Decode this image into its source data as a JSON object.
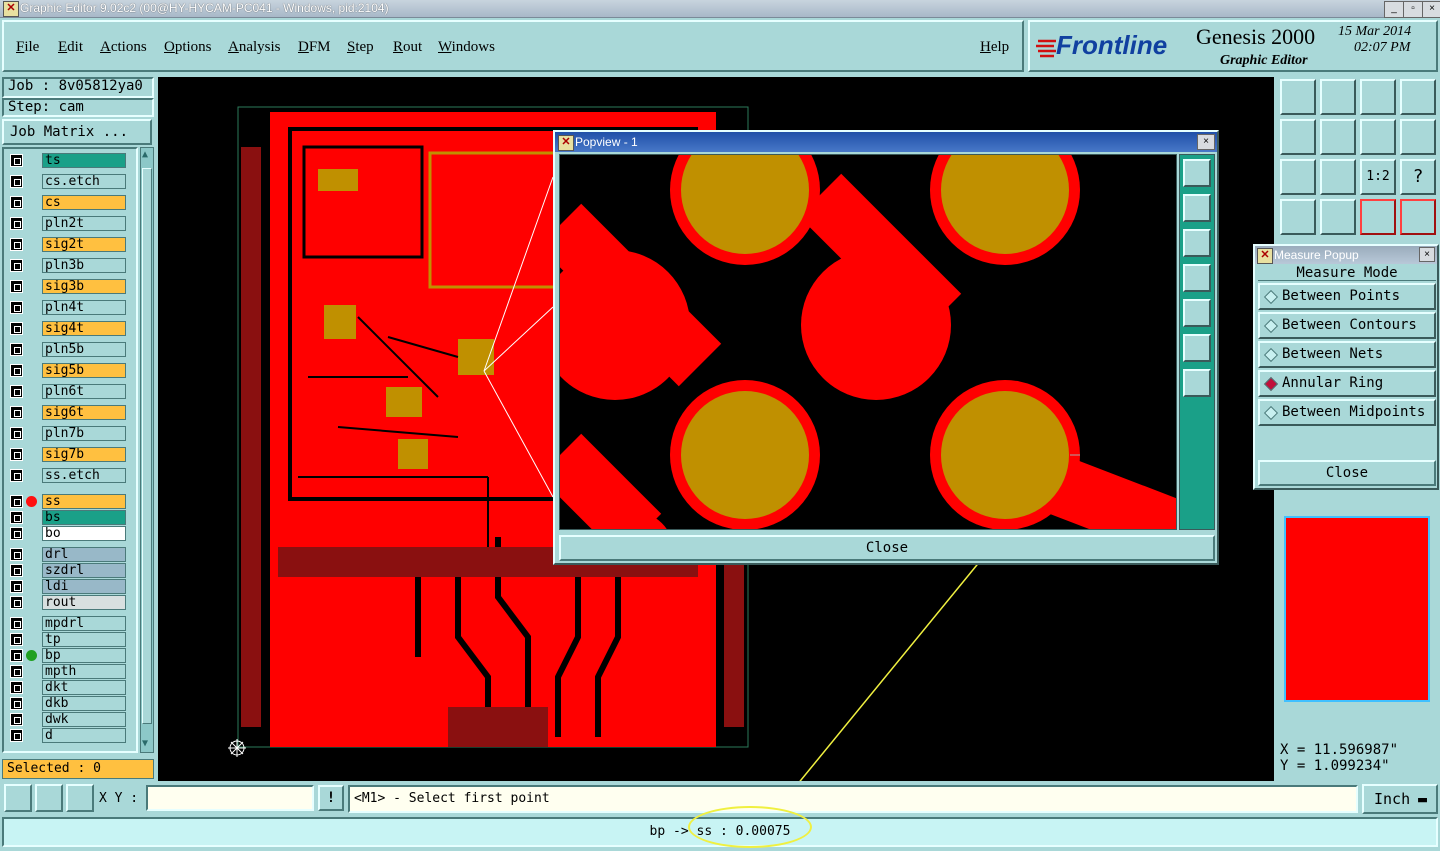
{
  "window": {
    "title": "Graphic Editor 9.02c2 (00@HY-HYCAM-PC041 - Windows, pid:2104)",
    "controls": [
      "_",
      "▫",
      "×"
    ]
  },
  "menubar": {
    "items": [
      "File",
      "Edit",
      "Actions",
      "Options",
      "Analysis",
      "DFM",
      "Step",
      "Rout",
      "Windows"
    ],
    "help": "Help"
  },
  "logo": {
    "brand": "Frontline",
    "product": "Genesis 2000",
    "subtitle": "Graphic Editor",
    "date": "15 Mar 2014",
    "time": "02:07 PM"
  },
  "job_panel": {
    "job": "Job : 8v05812ya0",
    "step": "Step: cam",
    "matrix_button": "Job Matrix ..."
  },
  "layers": [
    {
      "name": "ts",
      "color": "#1aa088",
      "marker": ""
    },
    {
      "name": "cs.etch",
      "color": "#a9d8d8",
      "marker": ""
    },
    {
      "name": "cs",
      "color": "#ffc040",
      "marker": ""
    },
    {
      "name": "pln2t",
      "color": "#a9d8d8",
      "marker": ""
    },
    {
      "name": "sig2t",
      "color": "#ffc040",
      "marker": ""
    },
    {
      "name": "pln3b",
      "color": "#a9d8d8",
      "marker": ""
    },
    {
      "name": "sig3b",
      "color": "#ffc040",
      "marker": ""
    },
    {
      "name": "pln4t",
      "color": "#a9d8d8",
      "marker": ""
    },
    {
      "name": "sig4t",
      "color": "#ffc040",
      "marker": ""
    },
    {
      "name": "pln5b",
      "color": "#a9d8d8",
      "marker": ""
    },
    {
      "name": "sig5b",
      "color": "#ffc040",
      "marker": ""
    },
    {
      "name": "pln6t",
      "color": "#a9d8d8",
      "marker": ""
    },
    {
      "name": "sig6t",
      "color": "#ffc040",
      "marker": ""
    },
    {
      "name": "pln7b",
      "color": "#a9d8d8",
      "marker": ""
    },
    {
      "name": "sig7b",
      "color": "#ffc040",
      "marker": ""
    },
    {
      "name": "ss.etch",
      "color": "#a9d8d8",
      "marker": ""
    },
    {
      "name": "ss",
      "color": "#ffc040",
      "marker": "red"
    },
    {
      "name": "bs",
      "color": "#1aa088",
      "marker": ""
    },
    {
      "name": "bo",
      "color": "#ffffff",
      "marker": ""
    },
    {
      "name": "drl",
      "color": "#98b8c8",
      "marker": ""
    },
    {
      "name": "szdrl",
      "color": "#98b8c8",
      "marker": ""
    },
    {
      "name": "ldi",
      "color": "#98b8c8",
      "marker": ""
    },
    {
      "name": "rout",
      "color": "#d8e0e0",
      "marker": ""
    },
    {
      "name": "mpdrl",
      "color": "#a9d8d8",
      "marker": ""
    },
    {
      "name": "tp",
      "color": "#a9d8d8",
      "marker": ""
    },
    {
      "name": "bp",
      "color": "#a9d8d8",
      "marker": "green"
    },
    {
      "name": "mpth",
      "color": "#a9d8d8",
      "marker": ""
    },
    {
      "name": "dkt",
      "color": "#a9d8d8",
      "marker": ""
    },
    {
      "name": "dkb",
      "color": "#a9d8d8",
      "marker": ""
    },
    {
      "name": "dwk",
      "color": "#a9d8d8",
      "marker": ""
    },
    {
      "name": "d",
      "color": "#a9d8d8",
      "marker": ""
    }
  ],
  "selected": "Selected : 0",
  "popview": {
    "title": "Popview - 1",
    "close": "Close"
  },
  "measure_popup": {
    "title": "Measure Popup",
    "header": "Measure Mode",
    "options": [
      {
        "label": "Between Points",
        "selected": false
      },
      {
        "label": "Between Contours",
        "selected": false
      },
      {
        "label": "Between Nets",
        "selected": false
      },
      {
        "label": "Annular Ring",
        "selected": true
      },
      {
        "label": "Between Midpoints",
        "selected": false
      }
    ],
    "close": "Close"
  },
  "toolbar_icons": [
    "home-up-icon",
    "home-down-icon",
    "home-icon",
    "split-icon",
    "move-left-icon",
    "move-right-icon",
    "swap-icon",
    "snake-icon",
    "fit-icon",
    "center-icon",
    "scale-1-2-icon",
    "help-icon",
    "tools-icon",
    "grid-icon",
    "layers-icon",
    "layers-red-icon"
  ],
  "coords": {
    "x": "X = 11.596987\"",
    "y": "Y = 1.099234\""
  },
  "command": {
    "xy_label": "X Y :",
    "xy_value": "",
    "prompt": "<M1> - Select first point",
    "units": "Inch"
  },
  "status": "bp -> ss : 0.00075",
  "colors": {
    "panel": "#a9d8d8",
    "copper": "#ff0000",
    "pad": "#c09000",
    "annotation": "#f0f040"
  }
}
